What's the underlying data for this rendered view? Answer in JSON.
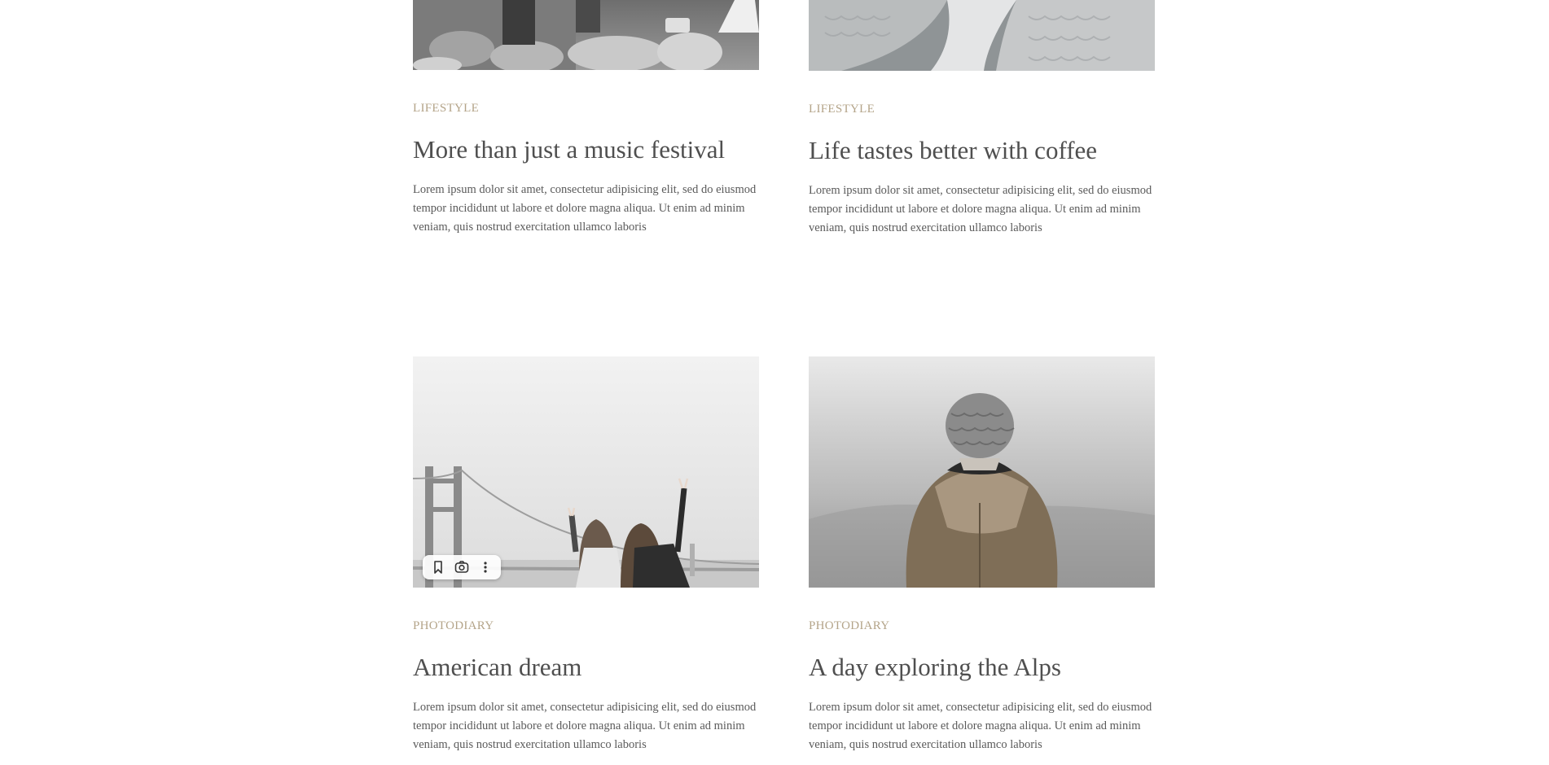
{
  "posts": [
    {
      "category": "LIFESTYLE",
      "title": "More than just a music festival",
      "excerpt": "Lorem ipsum dolor sit amet, consectetur adipisicing elit, sed do eiusmod tempor incididunt ut labore et dolore magna aliqua. Ut enim ad minim veniam, quis nostrud exercitation ullamco laboris"
    },
    {
      "category": "LIFESTYLE",
      "title": "Life tastes better with coffee",
      "excerpt": "Lorem ipsum dolor sit amet, consectetur adipisicing elit, sed do eiusmod tempor incididunt ut labore et dolore magna aliqua. Ut enim ad minim veniam, quis nostrud exercitation ullamco laboris"
    },
    {
      "category": "PHOTODIARY",
      "title": "American dream",
      "excerpt": "Lorem ipsum dolor sit amet, consectetur adipisicing elit, sed do eiusmod tempor incididunt ut labore et dolore magna aliqua. Ut enim ad minim veniam, quis nostrud exercitation ullamco laboris"
    },
    {
      "category": "PHOTODIARY",
      "title": "A day exploring the Alps",
      "excerpt": "Lorem ipsum dolor sit amet, consectetur adipisicing elit, sed do eiusmod tempor incididunt ut labore et dolore magna aliqua. Ut enim ad minim veniam, quis nostrud exercitation ullamco laboris"
    }
  ],
  "image_toolbar": {
    "icons": [
      "bookmark-icon",
      "lens-search-icon",
      "more-vertical-icon"
    ]
  },
  "colors": {
    "category": "#b4a489",
    "title": "#4f4f4f",
    "text": "#5a5a5a",
    "background": "#ffffff"
  }
}
